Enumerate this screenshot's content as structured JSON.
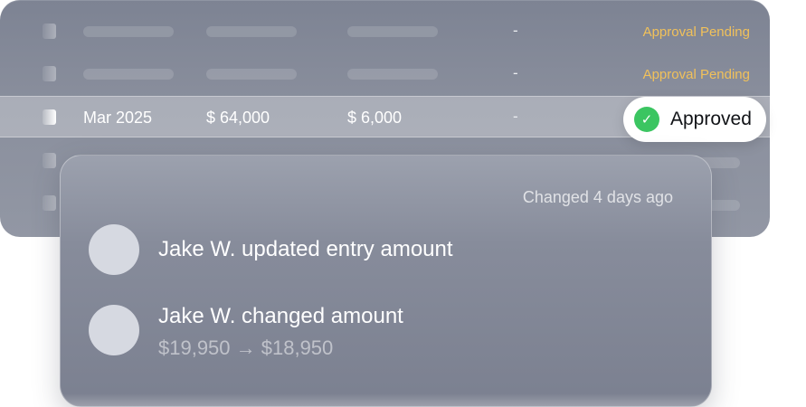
{
  "table": {
    "rows": [
      {
        "status": "Approval Pending",
        "mid": "-"
      },
      {
        "status": "Approval Pending",
        "mid": "-"
      },
      {
        "period": "Mar 2025",
        "amount": "$ 64,000",
        "delta": "$ 6,000",
        "mid": "-",
        "status": "Approved"
      }
    ],
    "colors": {
      "pending": "#f1c15a",
      "approved": "#3bc561"
    }
  },
  "activity": {
    "changed_ago": "Changed 4 days ago",
    "entries": [
      {
        "text": "Jake W. updated entry amount"
      },
      {
        "text": "Jake W. changed amount",
        "sub": "$19,950 → $18,950"
      }
    ]
  },
  "icons": {
    "approved": "check-circle-icon"
  }
}
